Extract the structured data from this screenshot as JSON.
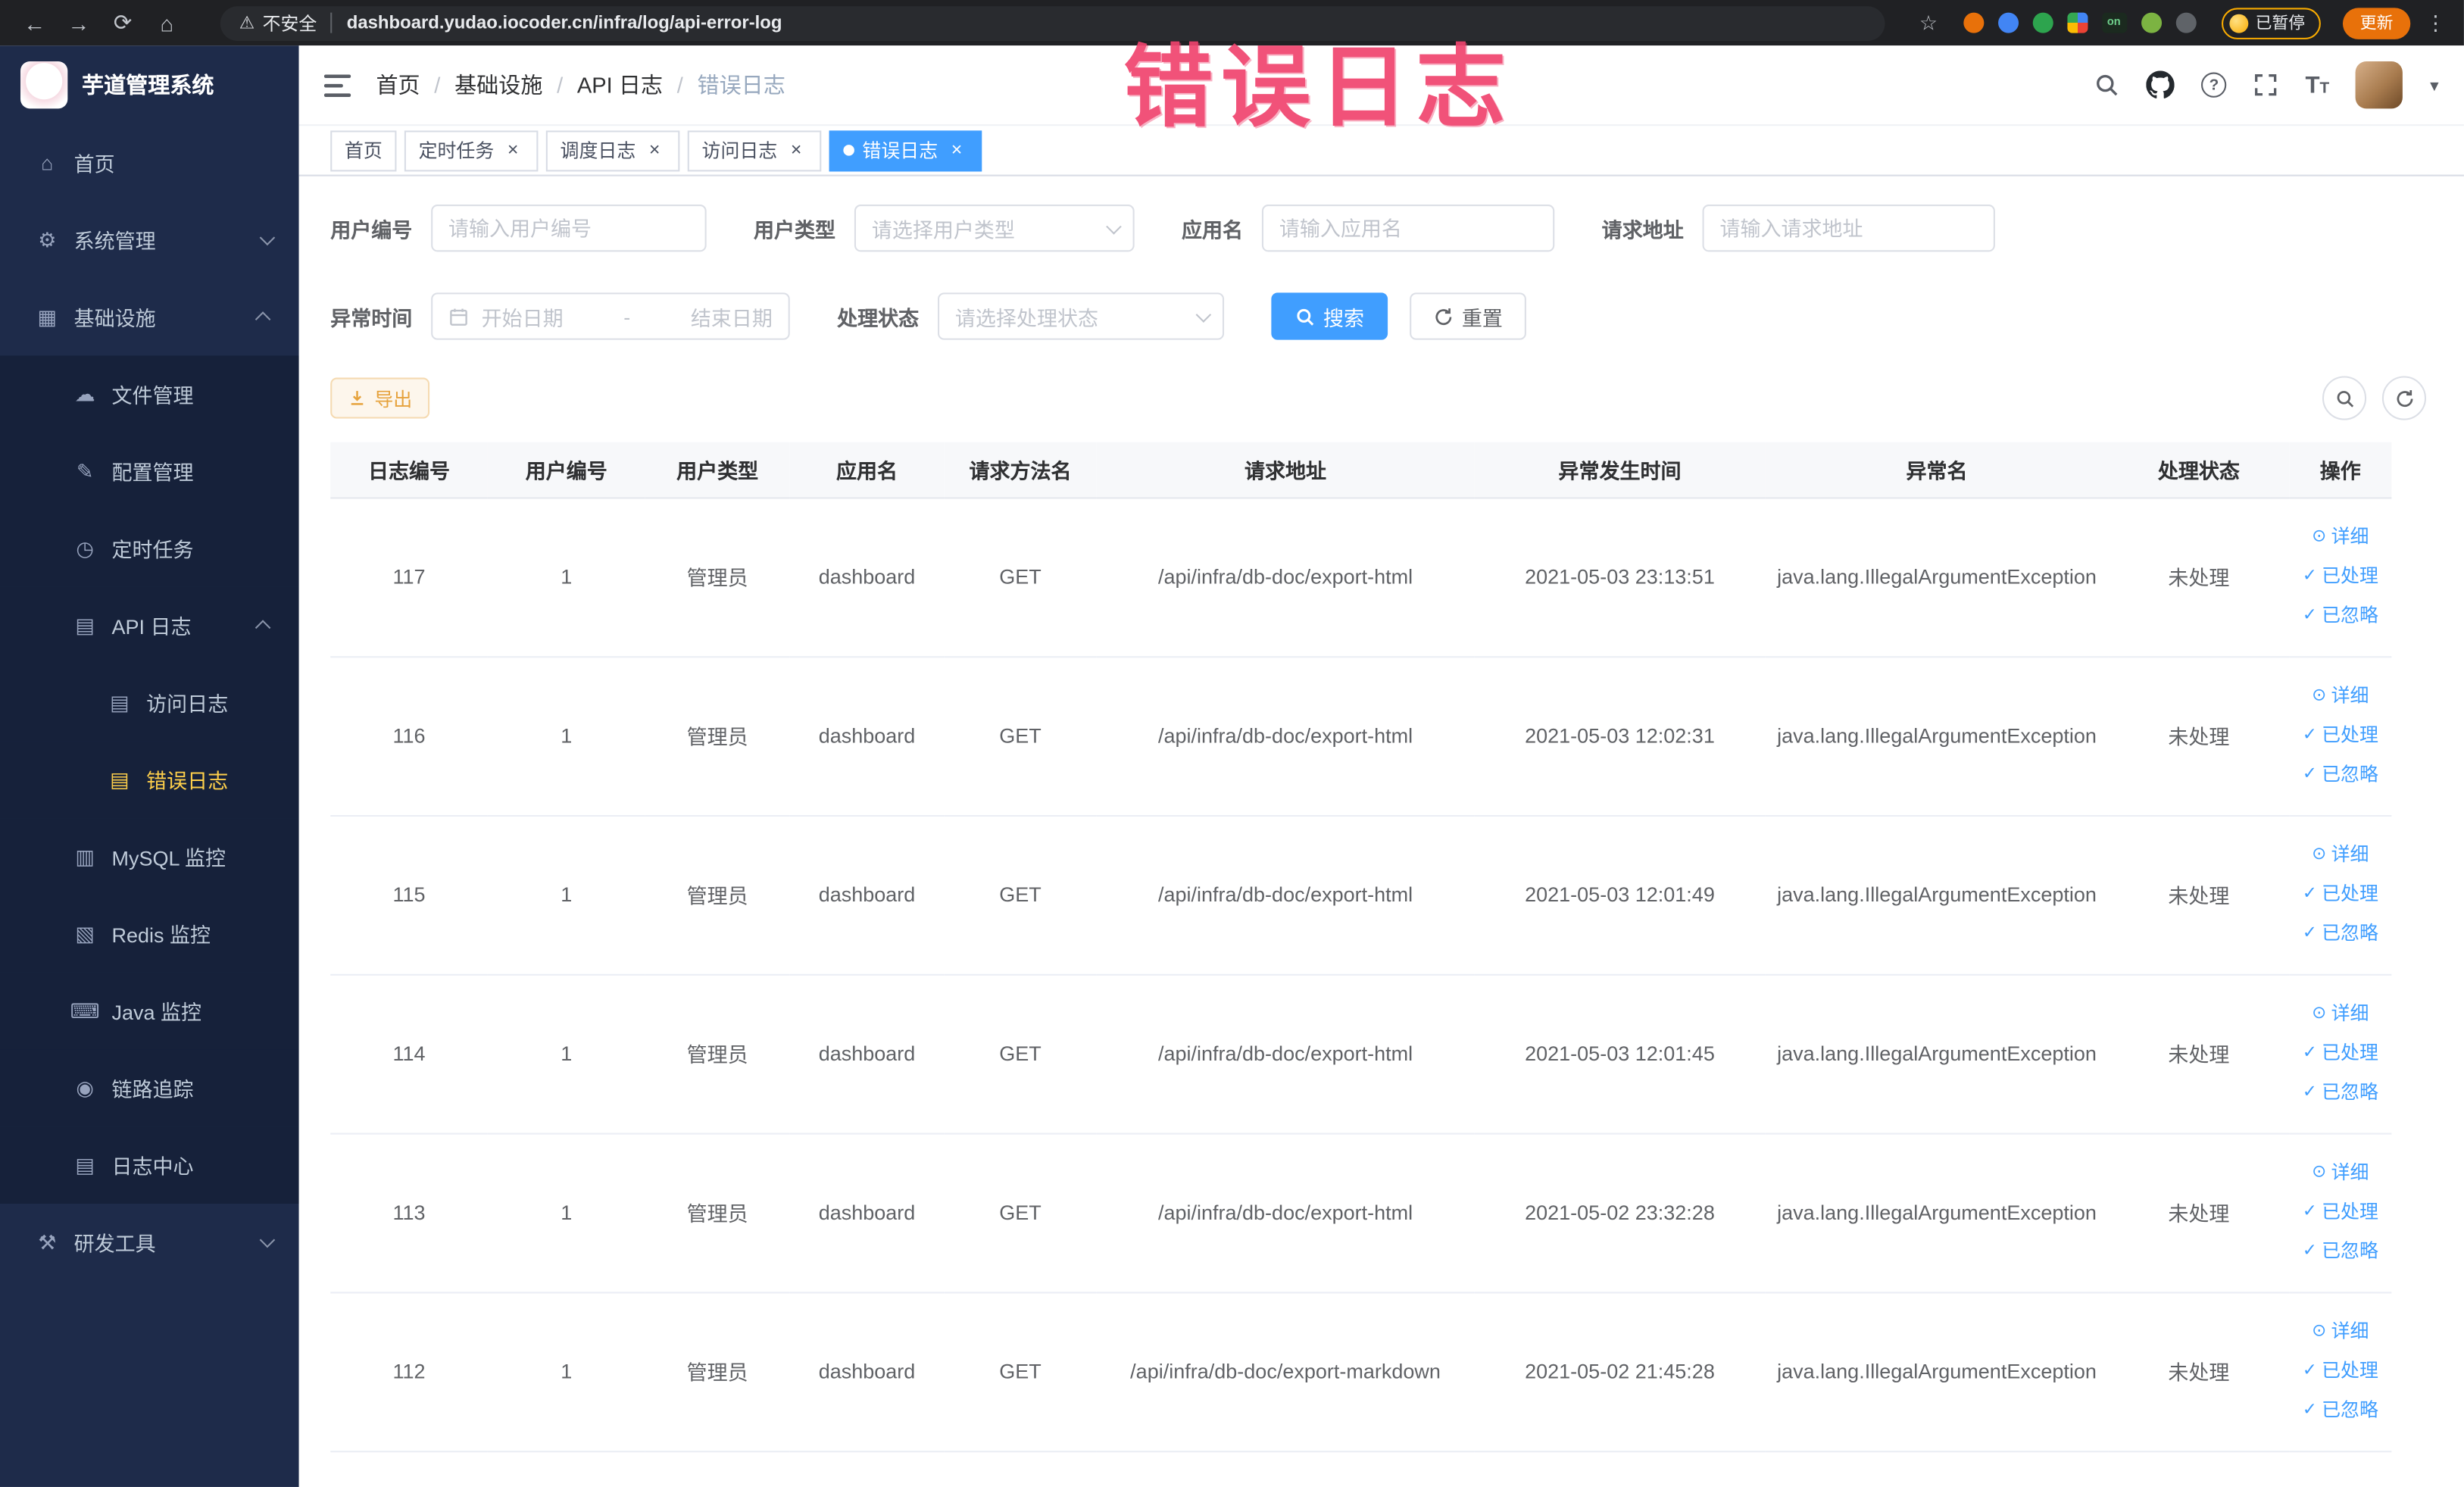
{
  "colors": {
    "accent": "#409eff",
    "sidebar_active": "#ffd04b",
    "warning": "#e6a23c",
    "annotation": "#f0446e"
  },
  "icons": {
    "back-icon": "←",
    "forward-icon": "→",
    "reload-icon": "⟳",
    "home-icon": "⌂",
    "warning-icon": "⚠",
    "star-icon": "☆",
    "more-icon": "⋮",
    "close-icon": "×",
    "caret-down-icon": "▾",
    "menu-home-icon": "⌂",
    "gear-icon": "⚙",
    "infra-icon": "▦",
    "cloud-icon": "☁",
    "edit-icon": "✎",
    "timer-icon": "◷",
    "apilog-icon": "▤",
    "doc-icon": "▤",
    "database-icon": "▥",
    "redis-icon": "▧",
    "java-icon": "⌨",
    "trace-icon": "◉",
    "tool-icon": "⚒",
    "eye-icon": "⊙",
    "check-icon": "✓"
  },
  "browser": {
    "security_label": "不安全",
    "url": "dashboard.yudao.iocoder.cn/infra/log/api-error-log",
    "extension_on_label": "on",
    "paused_label": "已暂停",
    "update_label": "更新"
  },
  "annotation": {
    "text": "错误日志"
  },
  "sidebar": {
    "logo_title": "芋道管理系统",
    "items": [
      {
        "id": "home",
        "icon": "menu-home-icon",
        "label": "首页",
        "depth": 0
      },
      {
        "id": "system",
        "icon": "gear-icon",
        "label": "系统管理",
        "depth": 0,
        "chevron": "down"
      },
      {
        "id": "infra",
        "icon": "infra-icon",
        "label": "基础设施",
        "depth": 0,
        "chevron": "up"
      },
      {
        "id": "file-manage",
        "icon": "cloud-icon",
        "label": "文件管理",
        "depth": 1,
        "dark": true
      },
      {
        "id": "config-manage",
        "icon": "edit-icon",
        "label": "配置管理",
        "depth": 1,
        "dark": true
      },
      {
        "id": "scheduled-jobs",
        "icon": "timer-icon",
        "label": "定时任务",
        "depth": 1,
        "dark": true
      },
      {
        "id": "api-log",
        "icon": "apilog-icon",
        "label": "API 日志",
        "depth": 1,
        "dark": true,
        "chevron": "up"
      },
      {
        "id": "access-log",
        "icon": "doc-icon",
        "label": "访问日志",
        "depth": 2,
        "dark": true
      },
      {
        "id": "error-log",
        "icon": "doc-icon",
        "label": "错误日志",
        "depth": 2,
        "dark": true,
        "active": true
      },
      {
        "id": "mysql-monitor",
        "icon": "database-icon",
        "label": "MySQL 监控",
        "depth": 1,
        "dark": true
      },
      {
        "id": "redis-monitor",
        "icon": "redis-icon",
        "label": "Redis 监控",
        "depth": 1,
        "dark": true
      },
      {
        "id": "java-monitor",
        "icon": "java-icon",
        "label": "Java 监控",
        "depth": 1,
        "dark": true
      },
      {
        "id": "trace",
        "icon": "trace-icon",
        "label": "链路追踪",
        "depth": 1,
        "dark": true
      },
      {
        "id": "log-center",
        "icon": "doc-icon",
        "label": "日志中心",
        "depth": 1,
        "dark": true
      },
      {
        "id": "dev-tools",
        "icon": "tool-icon",
        "label": "研发工具",
        "depth": 0,
        "chevron": "down"
      }
    ]
  },
  "header": {
    "breadcrumb": [
      "首页",
      "基础设施",
      "API 日志",
      "错误日志"
    ]
  },
  "tabs": [
    {
      "id": "home",
      "label": "首页",
      "closable": false,
      "active": false
    },
    {
      "id": "scheduled-jobs",
      "label": "定时任务",
      "closable": true,
      "active": false
    },
    {
      "id": "job-log",
      "label": "调度日志",
      "closable": true,
      "active": false
    },
    {
      "id": "access-log",
      "label": "访问日志",
      "closable": true,
      "active": false
    },
    {
      "id": "error-log",
      "label": "错误日志",
      "closable": true,
      "active": true
    }
  ],
  "filters": {
    "user_id": {
      "label": "用户编号",
      "placeholder": "请输入用户编号"
    },
    "user_type": {
      "label": "用户类型",
      "placeholder": "请选择用户类型"
    },
    "app_name": {
      "label": "应用名",
      "placeholder": "请输入应用名"
    },
    "request_url": {
      "label": "请求地址",
      "placeholder": "请输入请求地址"
    },
    "exception_time": {
      "label": "异常时间",
      "start_placeholder": "开始日期",
      "separator": "-",
      "end_placeholder": "结束日期"
    },
    "process_status": {
      "label": "处理状态",
      "placeholder": "请选择处理状态"
    },
    "search_label": "搜索",
    "reset_label": "重置"
  },
  "toolbar": {
    "export_label": "导出"
  },
  "table": {
    "columns": [
      "日志编号",
      "用户编号",
      "用户类型",
      "应用名",
      "请求方法名",
      "请求地址",
      "异常发生时间",
      "异常名",
      "处理状态",
      "操作"
    ],
    "row_actions": [
      {
        "name": "detail",
        "label": "详细",
        "icon": "eye-icon"
      },
      {
        "name": "processed",
        "label": "已处理",
        "icon": "check-icon"
      },
      {
        "name": "ignored",
        "label": "已忽略",
        "icon": "check-icon"
      }
    ],
    "rows": [
      {
        "id": "117",
        "user_id": "1",
        "user_type": "管理员",
        "app": "dashboard",
        "method": "GET",
        "url": "/api/infra/db-doc/export-html",
        "time": "2021-05-03 23:13:51",
        "exception": "java.lang.IllegalArgumentException",
        "status": "未处理"
      },
      {
        "id": "116",
        "user_id": "1",
        "user_type": "管理员",
        "app": "dashboard",
        "method": "GET",
        "url": "/api/infra/db-doc/export-html",
        "time": "2021-05-03 12:02:31",
        "exception": "java.lang.IllegalArgumentException",
        "status": "未处理"
      },
      {
        "id": "115",
        "user_id": "1",
        "user_type": "管理员",
        "app": "dashboard",
        "method": "GET",
        "url": "/api/infra/db-doc/export-html",
        "time": "2021-05-03 12:01:49",
        "exception": "java.lang.IllegalArgumentException",
        "status": "未处理"
      },
      {
        "id": "114",
        "user_id": "1",
        "user_type": "管理员",
        "app": "dashboard",
        "method": "GET",
        "url": "/api/infra/db-doc/export-html",
        "time": "2021-05-03 12:01:45",
        "exception": "java.lang.IllegalArgumentException",
        "status": "未处理"
      },
      {
        "id": "113",
        "user_id": "1",
        "user_type": "管理员",
        "app": "dashboard",
        "method": "GET",
        "url": "/api/infra/db-doc/export-html",
        "time": "2021-05-02 23:32:28",
        "exception": "java.lang.IllegalArgumentException",
        "status": "未处理"
      },
      {
        "id": "112",
        "user_id": "1",
        "user_type": "管理员",
        "app": "dashboard",
        "method": "GET",
        "url": "/api/infra/db-doc/export-markdown",
        "time": "2021-05-02 21:45:28",
        "exception": "java.lang.IllegalArgumentException",
        "status": "未处理"
      }
    ]
  }
}
